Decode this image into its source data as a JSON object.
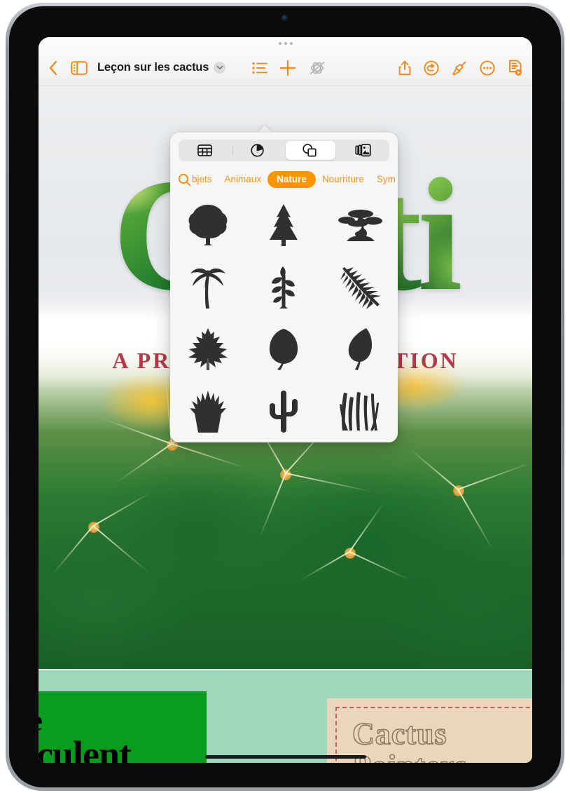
{
  "device": {
    "name": "iPad",
    "camera": "front-camera"
  },
  "app": {
    "name": "Keynote",
    "multitask_handle": "multitasking-dots"
  },
  "toolbar": {
    "back_label": "Back",
    "navigator_label": "Navigator",
    "document_title": "Leçon sur les cactus",
    "title_chevron": "chevron-down-icon",
    "format_label": "Format",
    "insert_label": "Insert",
    "animate_label": "Animate",
    "share_label": "Share",
    "undo_label": "Undo",
    "paintbrush_label": "Paintbrush",
    "more_label": "More",
    "play_label": "Play"
  },
  "popover": {
    "segments": [
      {
        "id": "table",
        "icon": "table-icon",
        "selected": false
      },
      {
        "id": "chart",
        "icon": "pie-chart-icon",
        "selected": false
      },
      {
        "id": "shape",
        "icon": "shapes-icon",
        "selected": true
      },
      {
        "id": "media",
        "icon": "media-icon",
        "selected": false
      }
    ],
    "search_icon": "search-icon",
    "categories": [
      {
        "label": "bjets",
        "selected": false
      },
      {
        "label": "Animaux",
        "selected": false
      },
      {
        "label": "Nature",
        "selected": true
      },
      {
        "label": "Nourriture",
        "selected": false
      },
      {
        "label": "Sym",
        "selected": false
      }
    ],
    "shapes": [
      "tree-icon",
      "pine-tree-icon",
      "bonsai-icon",
      "palm-tree-icon",
      "sprig-icon",
      "fern-icon",
      "maple-leaf-icon",
      "oval-leaf-icon",
      "pointed-leaf-icon",
      "potted-agave-icon",
      "cactus-icon",
      "grass-icon"
    ]
  },
  "slide": {
    "title": "Cacti",
    "subtitle": "A PRICKLY PRESENTATION"
  },
  "bottom_slides": {
    "left": {
      "line1": "e",
      "line2": "cculent"
    },
    "right": {
      "text": "Cactus Pointers"
    }
  },
  "colors": {
    "accent_orange": "#f08a1e",
    "selected_pill": "#fe9500",
    "title_red": "#b03a4a",
    "slide_mint": "#9ed7bb",
    "slide_green": "#0a9c1e",
    "card_beige": "#e9d6bd",
    "card_dash": "#c2605a"
  }
}
